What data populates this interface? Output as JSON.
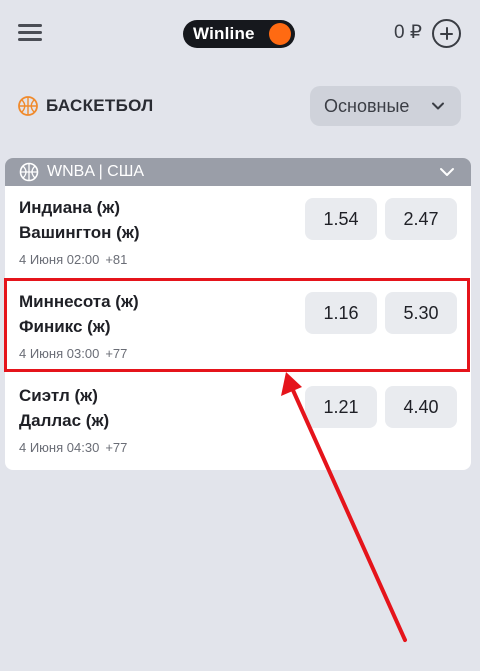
{
  "header": {
    "logo_text": "Winline",
    "balance": "0 ₽",
    "menu_icon": "hamburger-icon",
    "add_icon": "plus-circle-icon"
  },
  "sport": {
    "title": "БАСКЕТБОЛ",
    "icon": "basketball-icon",
    "filter_value": "Основные"
  },
  "league": {
    "name": "WNBA | США",
    "icon": "basketball-icon"
  },
  "matches": [
    {
      "team1": "Индиана (ж)",
      "team2": "Вашингтон (ж)",
      "date": "4 Июня 02:00",
      "more": "+81",
      "odd1": "1.54",
      "odd2": "2.47"
    },
    {
      "team1": "Миннесота (ж)",
      "team2": "Финикс (ж)",
      "date": "4 Июня 03:00",
      "more": "+77",
      "odd1": "1.16",
      "odd2": "5.30"
    },
    {
      "team1": "Сиэтл (ж)",
      "team2": "Даллас (ж)",
      "date": "4 Июня 04:30",
      "more": "+77",
      "odd1": "1.21",
      "odd2": "4.40"
    }
  ],
  "colors": {
    "accent_orange": "#ff6a12",
    "annotation_red": "#e5141b",
    "background": "#e2e4eb"
  }
}
